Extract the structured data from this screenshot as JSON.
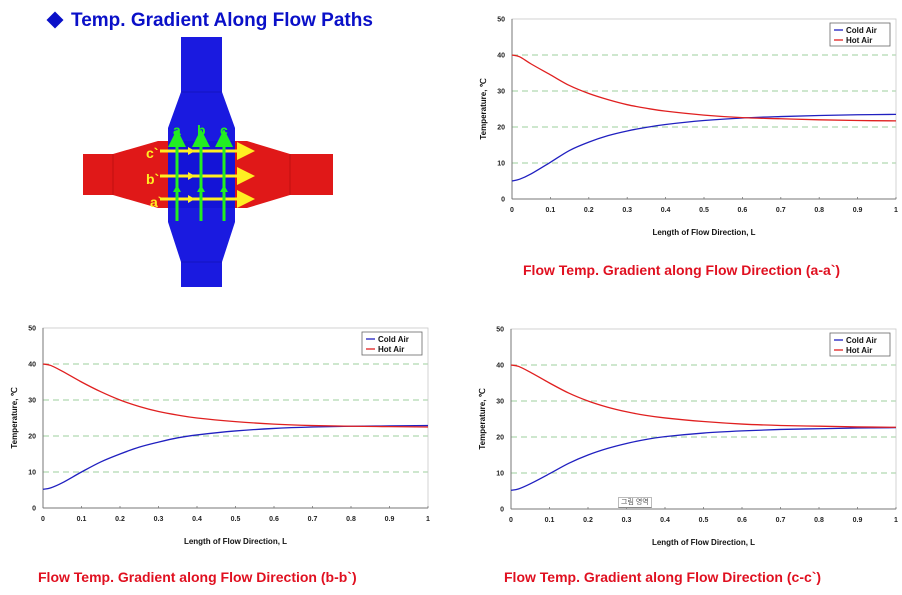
{
  "header": {
    "title": "Temp. Gradient Along Flow Paths",
    "bullet_icon": "diamond-bullet"
  },
  "diagram": {
    "colors": {
      "cold_duct": "#1a1ae0",
      "hot_duct": "#e01818",
      "cold_path": "#22ee22",
      "hot_path": "#ffee22"
    },
    "cold_path_labels": [
      "a",
      "b",
      "c"
    ],
    "hot_path_labels": [
      "c`",
      "b`",
      "a`"
    ]
  },
  "chart_data": [
    {
      "id": "a-a",
      "type": "line",
      "title": "Flow Temp. Gradient along Flow Direction (a-a`)",
      "xlabel": "Length of Flow Direction, L",
      "ylabel": "Temperature, ℃",
      "xlim": [
        0,
        1
      ],
      "ylim": [
        0,
        50
      ],
      "xticks": [
        "0",
        "0.1",
        "0.2",
        "0.3",
        "0.4",
        "0.5",
        "0.6",
        "0.7",
        "0.8",
        "0.9",
        "1"
      ],
      "yticks": [
        "0",
        "10",
        "20",
        "30",
        "40",
        "50"
      ],
      "grid": "horizontal dashed",
      "legend": "top-right",
      "x": [
        0,
        0.02,
        0.05,
        0.1,
        0.15,
        0.2,
        0.25,
        0.3,
        0.35,
        0.4,
        0.5,
        0.6,
        0.7,
        0.8,
        0.9,
        1.0
      ],
      "series": [
        {
          "name": "Cold Air",
          "color": "#2020c0",
          "values": [
            5.0,
            5.5,
            7.0,
            10.2,
            13.5,
            15.8,
            17.6,
            18.9,
            19.9,
            20.7,
            21.8,
            22.5,
            22.9,
            23.2,
            23.4,
            23.5
          ]
        },
        {
          "name": "Hot Air",
          "color": "#e02020",
          "values": [
            40.0,
            39.5,
            37.5,
            34.5,
            31.5,
            29.3,
            27.6,
            26.2,
            25.2,
            24.4,
            23.3,
            22.6,
            22.3,
            22.0,
            21.8,
            21.7
          ]
        }
      ]
    },
    {
      "id": "b-b",
      "type": "line",
      "title": "Flow Temp. Gradient along Flow Direction (b-b`)",
      "xlabel": "Length of Flow Direction, L",
      "ylabel": "Temperature, ℃",
      "xlim": [
        0,
        1
      ],
      "ylim": [
        0,
        50
      ],
      "xticks": [
        "0",
        "0.1",
        "0.2",
        "0.3",
        "0.4",
        "0.5",
        "0.6",
        "0.7",
        "0.8",
        "0.9",
        "1"
      ],
      "yticks": [
        "0",
        "10",
        "20",
        "30",
        "40",
        "50"
      ],
      "grid": "horizontal dashed",
      "legend": "top-right",
      "x": [
        0,
        0.02,
        0.05,
        0.1,
        0.15,
        0.2,
        0.25,
        0.3,
        0.35,
        0.4,
        0.5,
        0.6,
        0.7,
        0.8,
        0.9,
        1.0
      ],
      "series": [
        {
          "name": "Cold Air",
          "color": "#2020c0",
          "values": [
            5.2,
            5.6,
            7.0,
            10.0,
            12.8,
            15.0,
            16.9,
            18.3,
            19.5,
            20.3,
            21.4,
            22.1,
            22.5,
            22.7,
            22.8,
            22.9
          ]
        },
        {
          "name": "Hot Air",
          "color": "#e02020",
          "values": [
            40.0,
            39.6,
            38.0,
            35.0,
            32.3,
            30.0,
            28.2,
            26.8,
            25.8,
            25.0,
            24.0,
            23.3,
            22.9,
            22.7,
            22.6,
            22.5
          ]
        }
      ]
    },
    {
      "id": "c-c",
      "type": "line",
      "title": "Flow Temp. Gradient along Flow Direction (c-c`)",
      "xlabel": "Length of Flow Direction, L",
      "ylabel": "Temperature, ℃",
      "xlim": [
        0,
        1
      ],
      "ylim": [
        0,
        50
      ],
      "xticks": [
        "0",
        "0.1",
        "0.2",
        "0.3",
        "0.4",
        "0.5",
        "0.6",
        "0.7",
        "0.8",
        "0.9",
        "1"
      ],
      "yticks": [
        "0",
        "10",
        "20",
        "30",
        "40",
        "50"
      ],
      "grid": "horizontal dashed",
      "legend": "top-right",
      "annotation": "그림 영역",
      "x": [
        0,
        0.02,
        0.05,
        0.1,
        0.15,
        0.2,
        0.25,
        0.3,
        0.35,
        0.4,
        0.5,
        0.6,
        0.7,
        0.8,
        0.9,
        1.0
      ],
      "series": [
        {
          "name": "Cold Air",
          "color": "#2020c0",
          "values": [
            5.2,
            5.6,
            7.0,
            9.8,
            12.7,
            15.0,
            16.8,
            18.2,
            19.3,
            20.1,
            21.1,
            21.7,
            22.1,
            22.3,
            22.5,
            22.6
          ]
        },
        {
          "name": "Hot Air",
          "color": "#e02020",
          "values": [
            40.0,
            39.6,
            38.0,
            35.0,
            32.2,
            30.0,
            28.3,
            27.0,
            26.0,
            25.3,
            24.3,
            23.6,
            23.2,
            23.0,
            22.8,
            22.7
          ]
        }
      ]
    }
  ]
}
